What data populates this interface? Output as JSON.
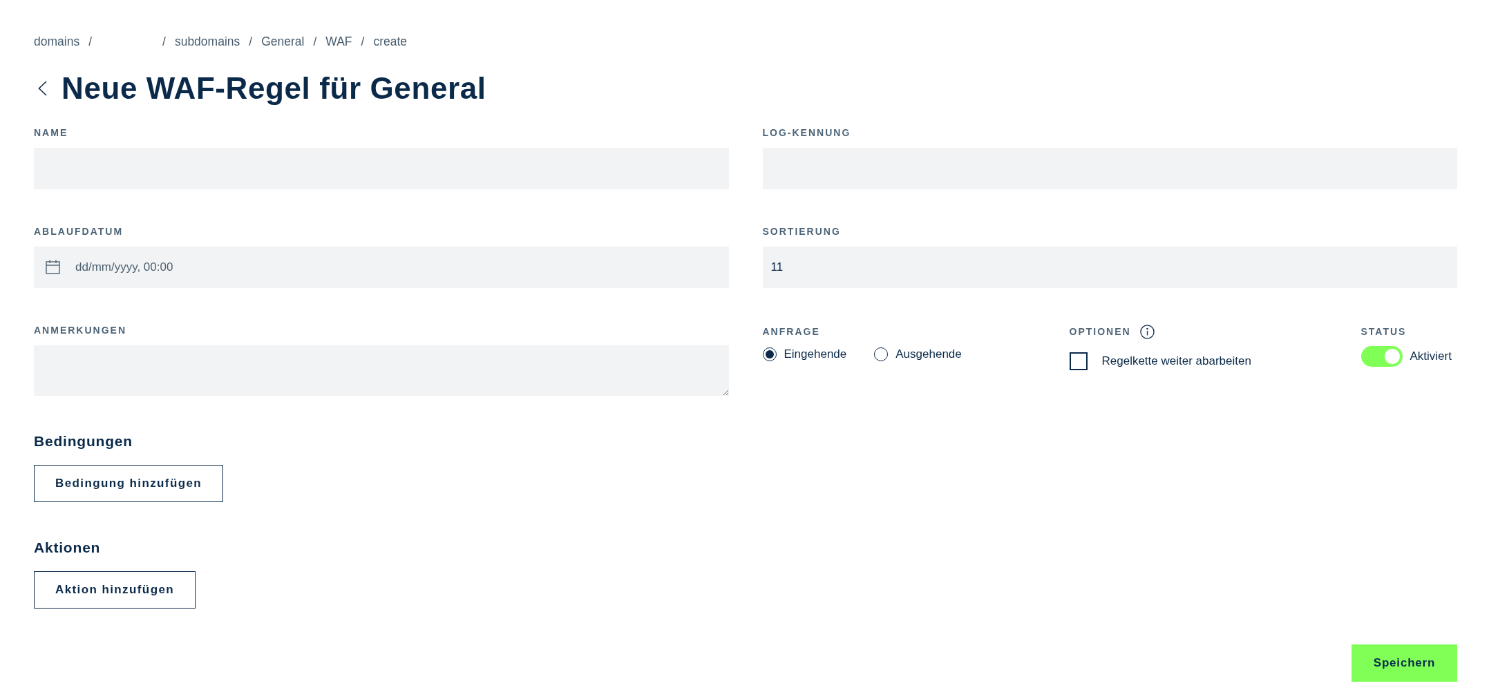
{
  "breadcrumb": {
    "separator": "/",
    "items": [
      {
        "kind": "link",
        "label": "domains"
      },
      {
        "kind": "blank"
      },
      {
        "kind": "link",
        "label": "subdomains"
      },
      {
        "kind": "link",
        "label": "General"
      },
      {
        "kind": "link",
        "label": "WAF"
      },
      {
        "kind": "link",
        "label": "create"
      }
    ]
  },
  "title": "Neue WAF-Regel für General",
  "fields": [
    {
      "kind": "text",
      "label": "NAME"
    },
    {
      "kind": "text",
      "label": "LOG-KENNUNG"
    },
    {
      "kind": "date",
      "label": "ABLAUFDATUM",
      "placeholder": "dd/mm/yyyy, 00:00"
    },
    {
      "kind": "text",
      "label": "SORTIERUNG",
      "value": "11"
    },
    {
      "kind": "textarea",
      "label": "ANMERKUNGEN"
    }
  ],
  "request": {
    "label": "ANFRAGE",
    "options": [
      {
        "label": "Eingehende",
        "selected": true
      },
      {
        "label": "Ausgehende",
        "selected": false
      }
    ]
  },
  "options": {
    "label": "OPTIONEN",
    "items": [
      {
        "label": "Regelkette weiter abarbeiten",
        "checked": false
      }
    ]
  },
  "status": {
    "label": "STATUS",
    "on": true,
    "text": "Aktiviert"
  },
  "sections": [
    {
      "heading": "Bedingungen",
      "button": "Bedingung hinzufügen"
    },
    {
      "heading": "Aktionen",
      "button": "Aktion hinzufügen"
    }
  ],
  "save_button": "Speichern"
}
